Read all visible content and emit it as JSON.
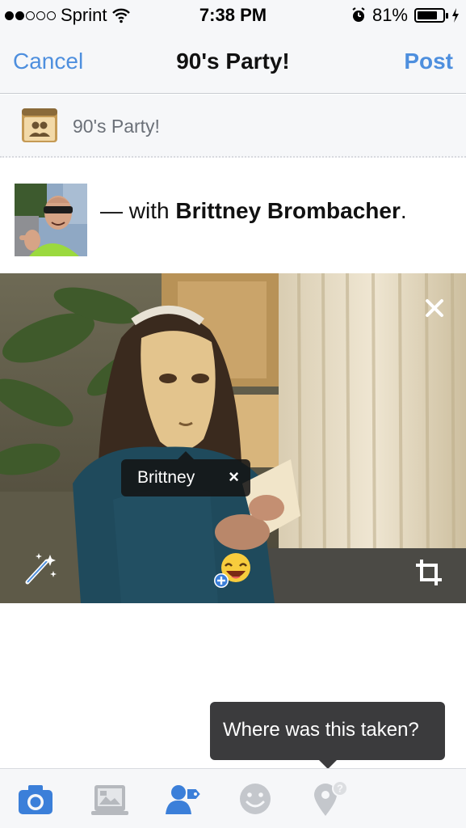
{
  "status_bar": {
    "carrier": "Sprint",
    "time": "7:38 PM",
    "battery": "81%",
    "battery_level": 0.81,
    "signal_bars": 2,
    "icons": [
      "signal-dots-icon",
      "wifi-icon",
      "alarm-icon",
      "battery-icon",
      "charging-bolt-icon"
    ]
  },
  "nav": {
    "cancel_label": "Cancel",
    "title": "90's Party!",
    "post_label": "Post"
  },
  "audience": {
    "icon": "group-icon",
    "label": "90's Party!"
  },
  "composer": {
    "with_prefix": "— with",
    "tagged_name": "Brittney Brombacher",
    "with_suffix": "."
  },
  "photo": {
    "tag_label": "Brittney",
    "tag_remove_glyph": "×",
    "icons": [
      "close-icon",
      "magic-wand-icon",
      "sticker-icon",
      "crop-icon"
    ]
  },
  "tooltip": {
    "text": "Where was this taken?"
  },
  "toolbar": {
    "items": [
      "camera-icon",
      "album-icon",
      "tag-people-icon",
      "feeling-icon",
      "location-icon"
    ],
    "active_color": "#3b7fd9",
    "inactive_color": "#c4c7cc"
  },
  "colors": {
    "accent": "#4e8fde",
    "bar_bg": "#f6f7f9"
  }
}
